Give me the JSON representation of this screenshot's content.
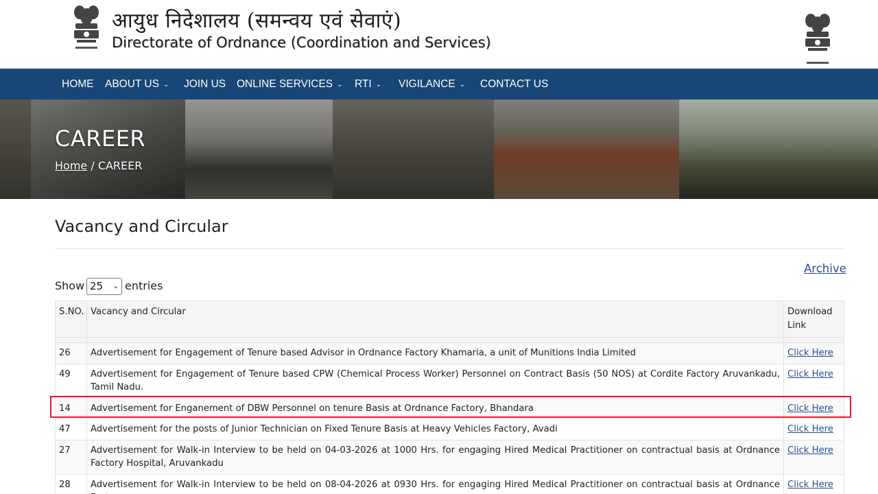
{
  "header": {
    "title_hindi": "आयुध निदेशालय (समन्वय एवं सेवाएं)",
    "title_english": "Directorate of Ordnance (Coordination and Services)",
    "emblem_icon": "national-emblem-icon"
  },
  "nav": {
    "items": [
      {
        "label": "HOME",
        "dropdown": false
      },
      {
        "label": "ABOUT US",
        "dropdown": true
      },
      {
        "label": "JOIN US",
        "dropdown": false
      },
      {
        "label": "ONLINE SERVICES",
        "dropdown": true
      },
      {
        "label": "RTI",
        "dropdown": true
      },
      {
        "label": "VIGILANCE",
        "dropdown": true
      },
      {
        "label": "CONTACT US",
        "dropdown": false
      }
    ],
    "chevron": "⌄"
  },
  "banner": {
    "title": "CAREER",
    "breadcrumb_home": "Home",
    "breadcrumb_sep": " / ",
    "breadcrumb_current": "CAREER"
  },
  "content": {
    "title": "Vacancy and Circular",
    "archive_label": "Archive",
    "show_label": "Show",
    "entries_value": "25",
    "entries_label": "entries"
  },
  "table": {
    "headers": [
      "S.NO.",
      "Vacancy and Circular",
      "Download Link"
    ],
    "rows": [
      {
        "sno": "26",
        "text": "Advertisement for Engagement of Tenure based Advisor in Ordnance Factory Khamaria, a unit of Munitions India Limited",
        "link": "Click Here"
      },
      {
        "sno": "49",
        "text": "Advertisement for Engagement of Tenure based CPW (Chemical Process Worker) Personnel on Contract Basis (50 NOS) at Cordite Factory Aruvankadu, Tamil Nadu.",
        "link": "Click Here"
      },
      {
        "sno": "14",
        "text": "Advertisement for Enganement of DBW Personnel on tenure Basis at Ordnance Factory, Bhandara",
        "link": "Click Here"
      },
      {
        "sno": "47",
        "text": "Advertisement for the posts of Junior Technician on Fixed Tenure Basis at Heavy Vehicles Factory, Avadi",
        "link": "Click Here"
      },
      {
        "sno": "27",
        "text": "Advertisement for Walk-in Interview to be held on 04-03-2026 at 1000 Hrs. for engaging Hired Medical Practitioner on contractual basis at Ordnance Factory Hospital, Aruvankadu",
        "link": "Click Here"
      },
      {
        "sno": "28",
        "text": "Advertisement for Walk-in Interview to be held on 08-04-2026 at 0930 Hrs. for engaging Hired Medical Practitioner on contractual basis at Ordnance Factory",
        "link": "Click Here"
      }
    ]
  },
  "colors": {
    "navbar": "#164776",
    "link": "#2a4d8f",
    "highlight": "#e01b22"
  }
}
